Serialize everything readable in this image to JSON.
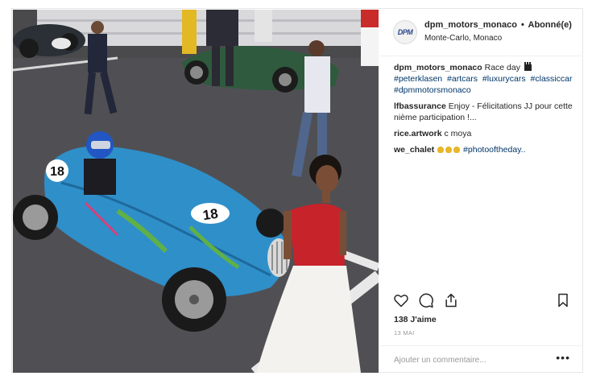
{
  "account": {
    "username": "dpm_motors_monaco",
    "separator": "•",
    "follow_status": "Abonné(e)",
    "location": "Monte-Carlo, Monaco",
    "avatar_text": "DPM"
  },
  "car": {
    "number": "18"
  },
  "caption": {
    "username": "dpm_motors_monaco",
    "text": "Race day",
    "hashtags": [
      "#peterklasen",
      "#artcars",
      "#luxurycars",
      "#classiccar",
      "#dpmmotorsmonaco"
    ]
  },
  "comments": [
    {
      "username": "lfbassurance",
      "text": "Enjoy - Félicitations JJ pour cette nième participation !..."
    },
    {
      "username": "rice.artwork",
      "text": "c moya"
    },
    {
      "username": "we_chalet",
      "text": "",
      "hashtag": "#photooftheday.."
    }
  ],
  "likes": "138 J'aime",
  "date": "13 MAI",
  "add_comment_placeholder": "Ajouter un commentaire...",
  "more_label": "•••",
  "icons": [
    "heart-icon",
    "comment-icon",
    "share-icon",
    "bookmark-icon",
    "clapperboard-emoji",
    "clapping-emoji"
  ],
  "colors": {
    "hashtag": "#003569",
    "car_blue": "#2f8fc9",
    "dress_red": "#c7232b"
  }
}
